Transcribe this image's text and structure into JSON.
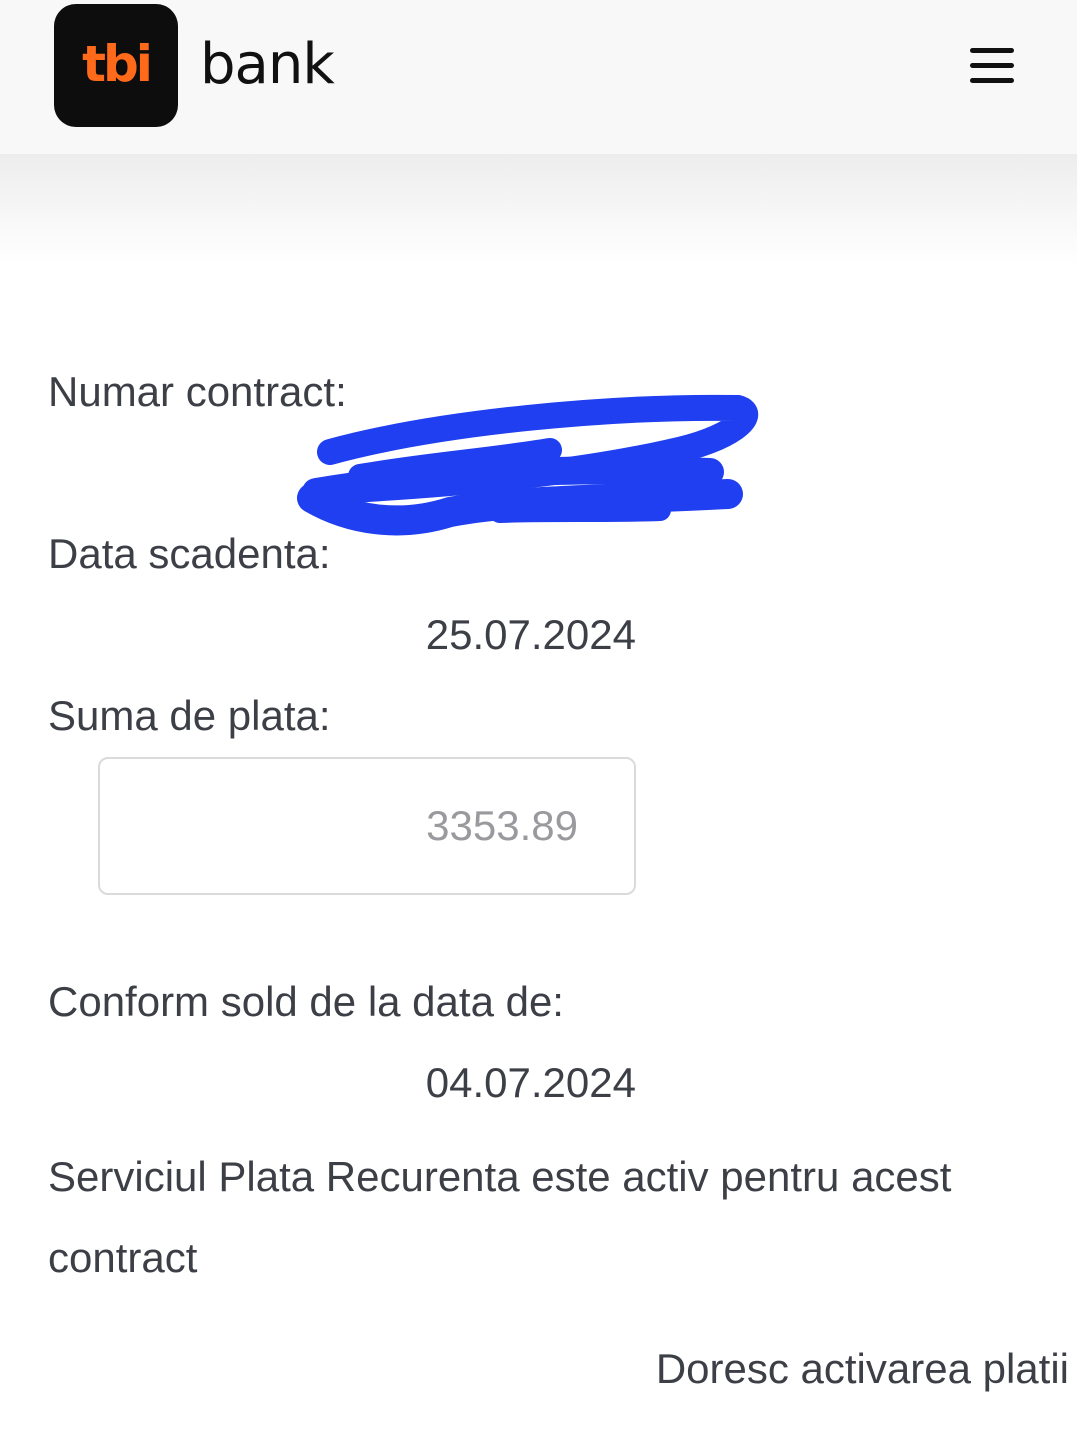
{
  "header": {
    "logo_text": "tbi",
    "brand_text": "bank",
    "menu_icon": "hamburger-menu-icon",
    "logo_text_color": "#ff6a1a",
    "logo_bg_color": "#0d0d0d"
  },
  "contract": {
    "number_label": "Numar contract:"
  },
  "due_date": {
    "label": "Data scadenta:",
    "value": "25.07.2024"
  },
  "payment": {
    "label": "Suma de plata:",
    "amount": "3353.89"
  },
  "balance": {
    "label": "Conform sold de la data de:",
    "date": "04.07.2024"
  },
  "recurring": {
    "status_text": "Serviciul Plata Recurenta este activ pentru acest contract"
  },
  "actions": {
    "activate_label": "Doresc activarea platii"
  },
  "colors": {
    "redaction": "#1f3ff0",
    "text": "#3d3f47"
  }
}
